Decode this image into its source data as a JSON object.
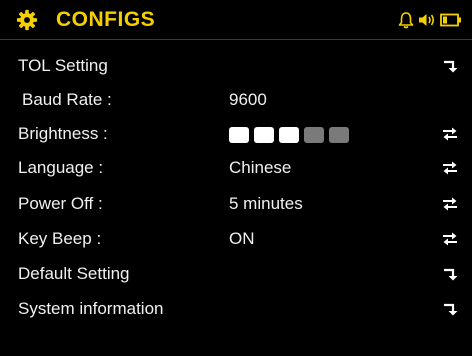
{
  "header": {
    "title": "CONFIGS",
    "title_color": "#f5d000",
    "left_icon": "gear-icon",
    "status_icons": [
      "bell-icon",
      "speaker-icon",
      "battery-icon"
    ]
  },
  "settings": [
    {
      "label": "TOL Setting",
      "value": "",
      "action_icon": "enter-arrow-icon"
    },
    {
      "label": "Baud Rate :",
      "value": "9600",
      "action_icon": ""
    },
    {
      "label": "Brightness :",
      "value": "",
      "action_icon": "swap-arrows-icon"
    },
    {
      "label": "Language  :",
      "value": "Chinese",
      "action_icon": "swap-arrows-icon"
    },
    {
      "label": "Power Off  :",
      "value": "5 minutes",
      "action_icon": "swap-arrows-icon"
    },
    {
      "label": "Key Beep  :",
      "value": "ON",
      "action_icon": "swap-arrows-icon"
    },
    {
      "label": "Default Setting",
      "value": "",
      "action_icon": "enter-arrow-icon"
    },
    {
      "label": "System information",
      "value": "",
      "action_icon": "enter-arrow-icon"
    }
  ],
  "brightness": {
    "level": 3,
    "max": 5,
    "on_color": "#ffffff",
    "off_color": "#7a7a7a"
  }
}
